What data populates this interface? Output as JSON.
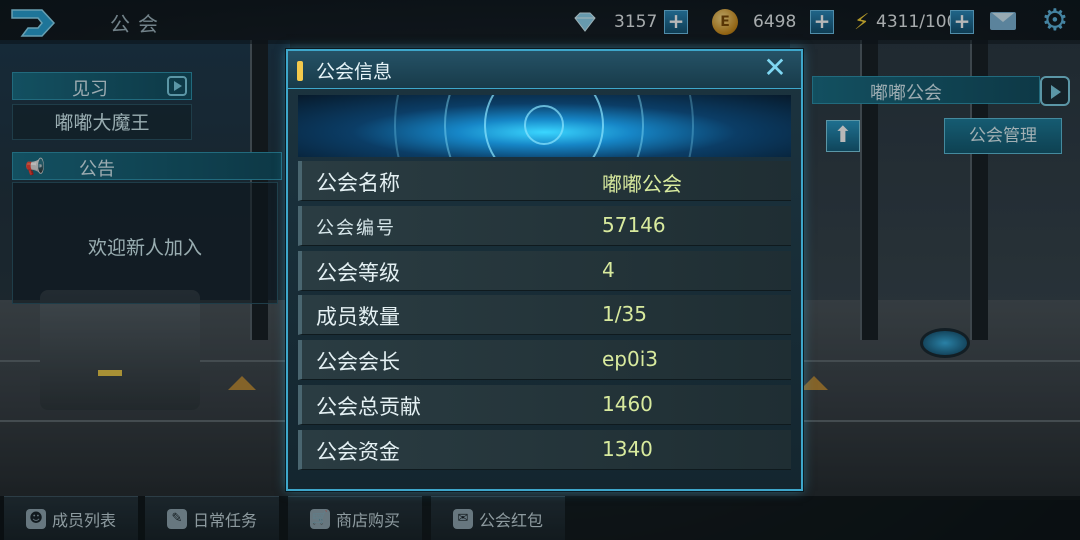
{
  "topbar": {
    "title": "公会",
    "gems": "3157",
    "coins": "6498",
    "coin_symbol": "E",
    "energy": "4311/100"
  },
  "left_panel": {
    "rank_title": "见习",
    "player_name": "嘟嘟大魔王",
    "notice_title": "公告",
    "notice_text": "欢迎新人加入"
  },
  "right_panel": {
    "guild_name_header": "嘟嘟公会",
    "manage_button": "公会管理"
  },
  "modal": {
    "title": "公会信息",
    "rows": [
      {
        "label": "公会名称",
        "value": "嘟嘟公会"
      },
      {
        "label": "公会编号",
        "value": "57146"
      },
      {
        "label": "公会等级",
        "value": "4"
      },
      {
        "label": "成员数量",
        "value": "1/35"
      },
      {
        "label": "公会会长",
        "value": "ep0i3"
      },
      {
        "label": "公会总贡献",
        "value": "1460"
      },
      {
        "label": "公会资金",
        "value": "1340"
      }
    ]
  },
  "bottom_tabs": [
    {
      "label": "成员列表",
      "icon": "member-icon"
    },
    {
      "label": "日常任务",
      "icon": "task-icon"
    },
    {
      "label": "商店购买",
      "icon": "cart-icon"
    },
    {
      "label": "公会红包",
      "icon": "red-envelope-icon"
    }
  ],
  "colors": {
    "accent": "#3ea7cb",
    "value_text": "#d8ea9e",
    "title_accent": "#f2c94c"
  }
}
